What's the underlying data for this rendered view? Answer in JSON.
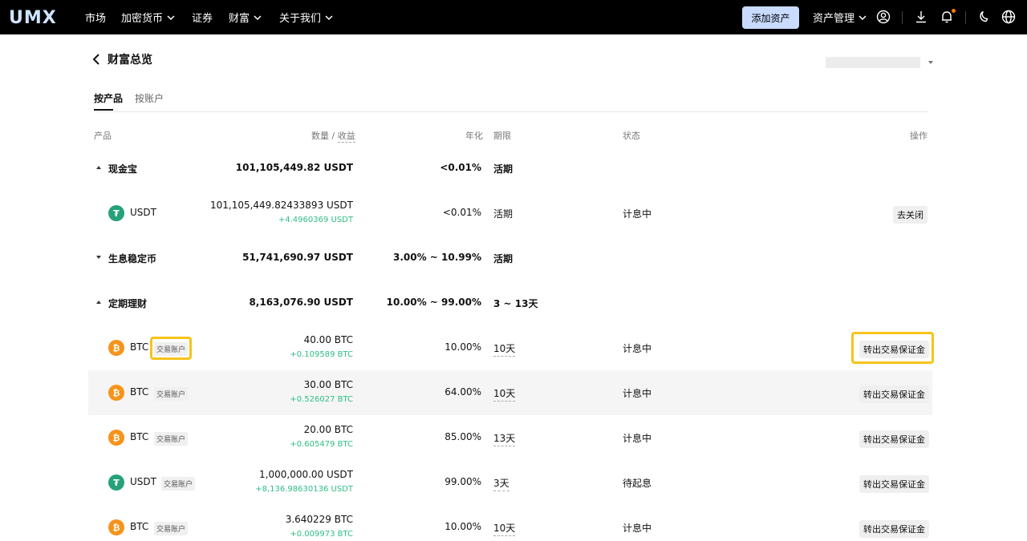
{
  "nav": {
    "logo": "UMX",
    "items": [
      "市场",
      "加密货币",
      "证券",
      "财富",
      "关于我们"
    ],
    "add_asset": "添加资产",
    "asset_mgmt": "资产管理",
    "icons": [
      "user-icon",
      "download-icon",
      "bell-icon",
      "moon-icon",
      "globe-icon"
    ],
    "notify_color": "#ff7a00"
  },
  "page": {
    "title": "财富总览",
    "tabs": [
      "按产品",
      "按账户"
    ]
  },
  "table": {
    "headers": {
      "product": "产品",
      "qty": "数量",
      "qty_sep": " / ",
      "earn": "收益",
      "apr": "年化",
      "term": "期限",
      "status": "状态",
      "action": "操作"
    },
    "groups": [
      {
        "name": "现金宝",
        "amount": "101,105,449.82 USDT",
        "apr": "<0.01%",
        "term": "活期",
        "expanded": true
      },
      {
        "name": "生息稳定币",
        "amount": "51,741,690.97 USDT",
        "apr": "3.00% ~ 10.99%",
        "term": "活期",
        "expanded": false
      },
      {
        "name": "定期理财",
        "amount": "8,163,076.90 USDT",
        "apr": "10.00% ~ 99.00%",
        "term": "3 ~ 13天",
        "expanded": true
      }
    ],
    "cash_item": {
      "coin": "USDT",
      "amount": "101,105,449.82433893 USDT",
      "gain": "+4.4960369 USDT",
      "apr": "<0.01%",
      "term": "活期",
      "status": "计息中",
      "action": "去关闭"
    },
    "fixed_items": [
      {
        "coin": "BTC",
        "tag": "交易账户",
        "amount": "40.00 BTC",
        "gain": "+0.109589 BTC",
        "apr": "10.00%",
        "term": "10天",
        "status": "计息中",
        "action": "转出交易保证金"
      },
      {
        "coin": "BTC",
        "tag": "交易账户",
        "amount": "30.00 BTC",
        "gain": "+0.526027 BTC",
        "apr": "64.00%",
        "term": "10天",
        "status": "计息中",
        "action": "转出交易保证金"
      },
      {
        "coin": "BTC",
        "tag": "交易账户",
        "amount": "20.00 BTC",
        "gain": "+0.605479 BTC",
        "apr": "85.00%",
        "term": "13天",
        "status": "计息中",
        "action": "转出交易保证金"
      },
      {
        "coin": "USDT",
        "tag": "交易账户",
        "amount": "1,000,000.00 USDT",
        "gain": "+8,136.98630136 USDT",
        "apr": "99.00%",
        "term": "3天",
        "status": "待起息",
        "action": "转出交易保证金"
      },
      {
        "coin": "BTC",
        "tag": "交易账户",
        "amount": "3.640229 BTC",
        "gain": "+0.009973 BTC",
        "apr": "10.00%",
        "term": "10天",
        "status": "计息中",
        "action": "转出交易保证金"
      }
    ],
    "colors": {
      "gain": "#2ebd85",
      "btc": "#f7931a",
      "usdt": "#26a17b",
      "highlight": "#f7c31a"
    }
  }
}
